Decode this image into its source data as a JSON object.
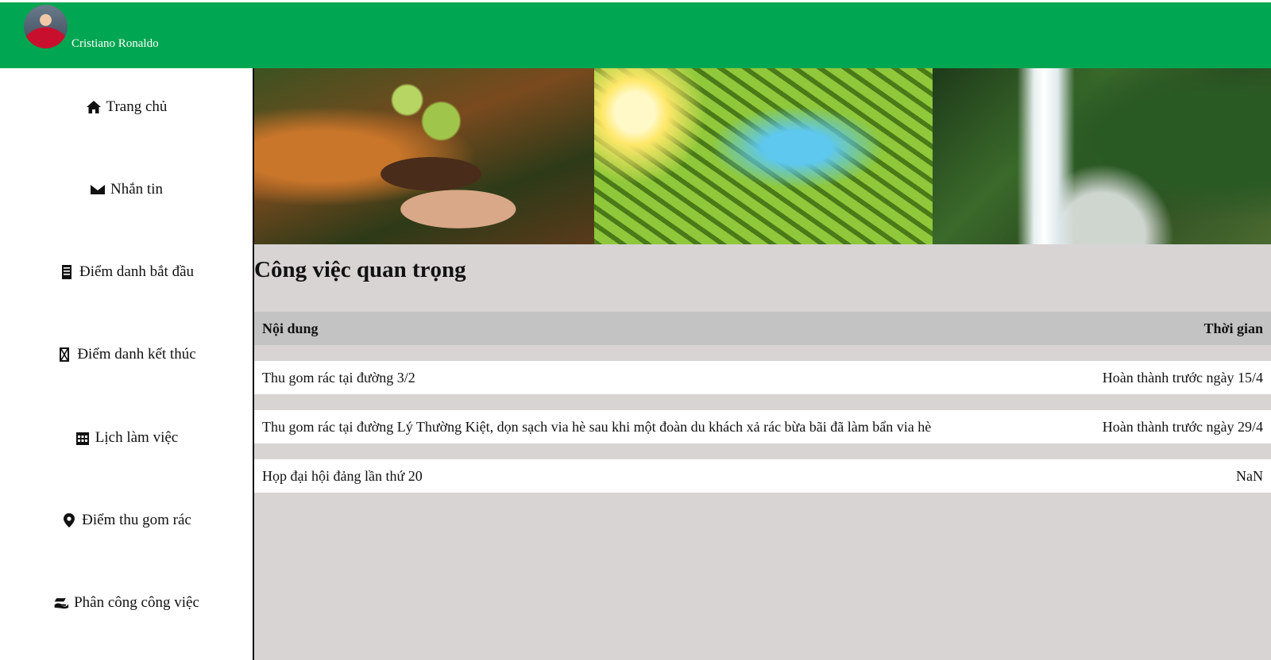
{
  "header": {
    "user_name": "Cristiano Ronaldo",
    "background_color": "#00a651"
  },
  "sidebar": {
    "items": [
      {
        "label": "Trang chủ",
        "icon": "home-icon"
      },
      {
        "label": "Nhắn tin",
        "icon": "envelope-icon"
      },
      {
        "label": "Điểm danh bắt đầu",
        "icon": "clipboard-icon"
      },
      {
        "label": "Điểm danh kết thúc",
        "icon": "hourglass-icon"
      },
      {
        "label": "Lịch làm việc",
        "icon": "calendar-icon"
      },
      {
        "label": "Điểm thu gom rác",
        "icon": "map-pin-icon"
      },
      {
        "label": "Phân công công việc",
        "icon": "hand-holding-icon"
      }
    ]
  },
  "banner": {
    "images": [
      "seedling-in-hands",
      "forest-canopy-sky",
      "waterfall-jungle"
    ]
  },
  "main": {
    "title": "Công việc quan trọng",
    "table": {
      "headers": {
        "content": "Nội dung",
        "time": "Thời gian"
      },
      "rows": [
        {
          "content": "Thu gom rác tại đường 3/2",
          "time": "Hoàn thành trước ngày 15/4"
        },
        {
          "content": "Thu gom rác tại đường Lý Thường Kiệt, dọn sạch via hè sau khi một đoàn du khách xả rác bừa bãi đã làm bẩn via hè",
          "time": "Hoàn thành trước ngày 29/4"
        },
        {
          "content": "Họp đại hội đảng lần thứ 20",
          "time": "NaN"
        }
      ]
    }
  }
}
